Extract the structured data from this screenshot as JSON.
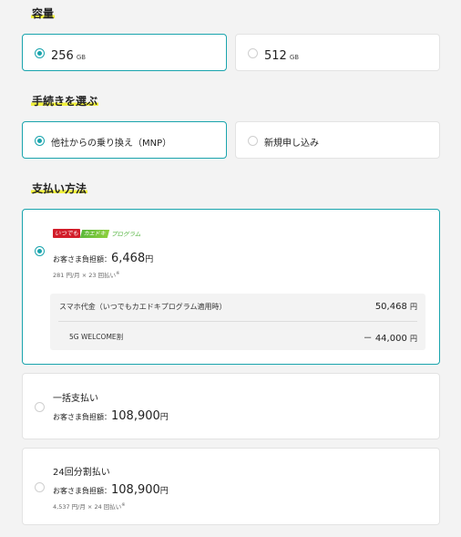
{
  "capacity": {
    "heading": "容量",
    "options": [
      {
        "value": "256",
        "unit": "GB",
        "selected": true
      },
      {
        "value": "512",
        "unit": "GB",
        "selected": false
      }
    ]
  },
  "procedure": {
    "heading": "手続きを選ぶ",
    "options": [
      {
        "label": "他社からの乗り換え（MNP）",
        "selected": true
      },
      {
        "label": "新規申し込み",
        "selected": false
      }
    ]
  },
  "payment": {
    "heading": "支払い方法",
    "installment_program": {
      "logo_brand": "いつでも",
      "logo_name": "カエドキ",
      "logo_suffix": "プログラム",
      "burden_label": "お客さま負担額：",
      "price": "6,468",
      "price_unit": "円",
      "breakdown": "281 円/月 × 23 回払い",
      "breakdown_mark": "※",
      "selected": true,
      "details": [
        {
          "label": "スマホ代金（いつでもカエドキプログラム適用時）",
          "value": "50,468",
          "unit": "円"
        },
        {
          "label": "5G WELCOME割",
          "value": "－ 44,000",
          "unit": "円"
        }
      ]
    },
    "lump_sum": {
      "title": "一括支払い",
      "burden_label": "お客さま負担額：",
      "price": "108,900",
      "price_unit": "円",
      "selected": false
    },
    "split24": {
      "title": "24回分割払い",
      "burden_label": "お客さま負担額：",
      "price": "108,900",
      "price_unit": "円",
      "breakdown": "4,537 円/月 × 24 回払い",
      "breakdown_mark": "※",
      "selected": false
    }
  },
  "colors": {
    "accent": "#1aa4ad",
    "highlight": "#f0f03c",
    "background": "#f3f3f3"
  }
}
